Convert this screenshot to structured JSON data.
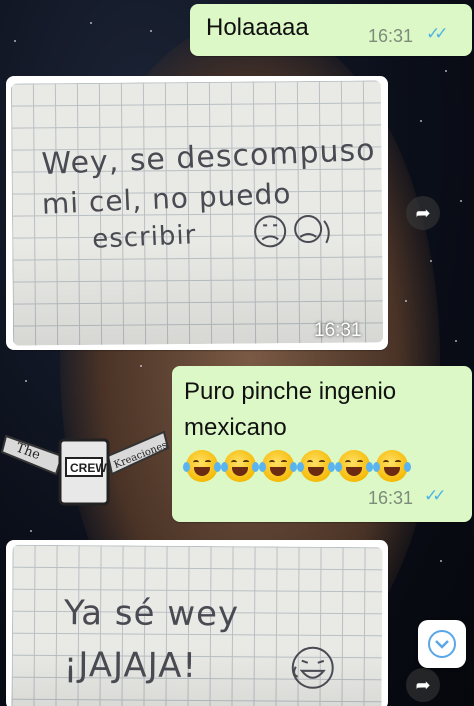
{
  "messages": [
    {
      "text": "Holaaaaa",
      "time": "16:31",
      "status": "read"
    },
    {
      "photo_handwriting": [
        "Wey, se descompuso",
        "mi cel, no puedo",
        "escribir"
      ],
      "time": "16:31"
    },
    {
      "text_line1": "Puro pinche ingenio",
      "text_line2": "mexicano",
      "emojis": [
        "face-with-tears-of-joy",
        "face-with-tears-of-joy",
        "face-with-tears-of-joy",
        "face-with-tears-of-joy",
        "face-with-tears-of-joy",
        "face-with-tears-of-joy"
      ],
      "time": "16:31",
      "status": "read"
    },
    {
      "photo_handwriting": [
        "Ya sé wey",
        "¡JAJAJA!"
      ]
    }
  ],
  "watermark": {
    "left": "The",
    "center": "CREW",
    "right": "Kreaciones"
  },
  "colors": {
    "outgoing_bubble": "#dcf8c6",
    "read_ticks": "#4fb3e6",
    "time_text": "#7d8b7a"
  }
}
